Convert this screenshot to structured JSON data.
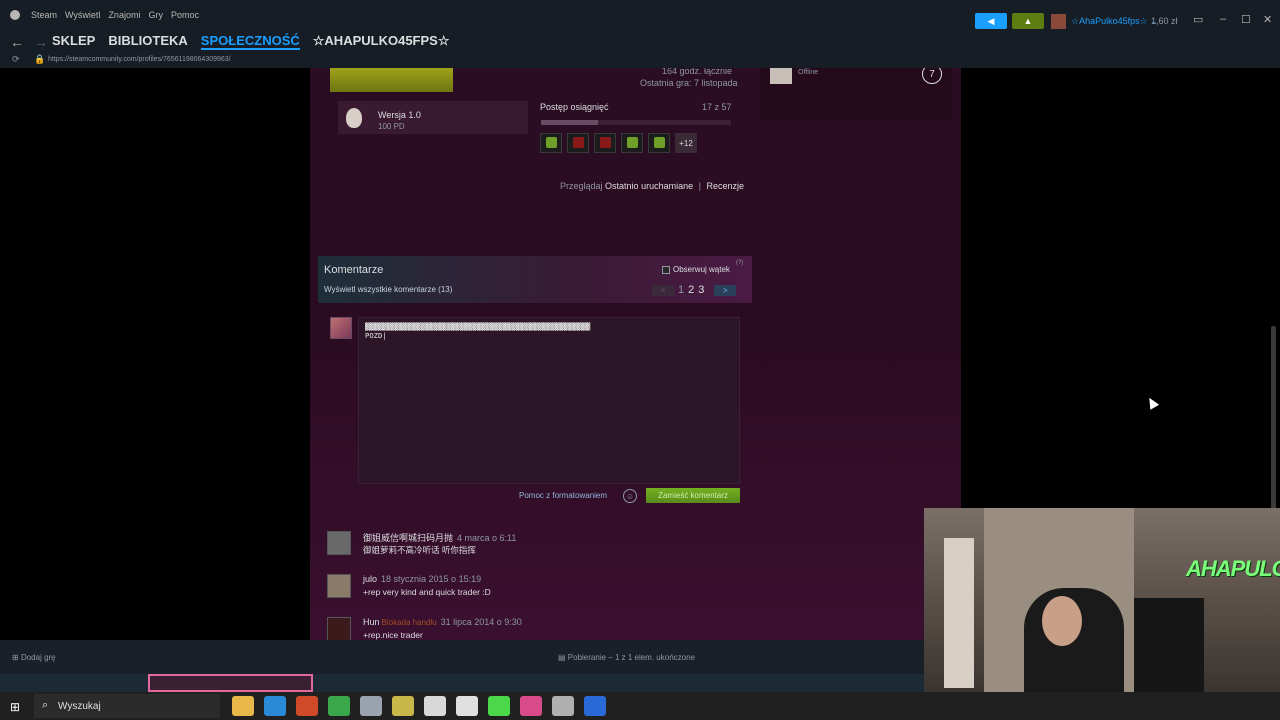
{
  "titlebar": {
    "menu": [
      "Steam",
      "Wyświetl",
      "Znajomi",
      "Gry",
      "Pomoc"
    ],
    "username": "☆AhaPulko45fps☆",
    "wallet": "1,60 zł"
  },
  "nav": {
    "links": [
      "SKLEP",
      "BIBLIOTEKA",
      "SPOŁECZNOŚĆ",
      "☆AHAPULKO45FPS☆"
    ],
    "active_index": 2,
    "url": "https://steamcommunity.com/profiles/76561198064309963/"
  },
  "game": {
    "hours": "164 godz. łącznie",
    "last_played": "Ostatnia gra: 7 listopada",
    "version_name": "Wersja 1.0",
    "version_points": "100 PD",
    "achievements_label": "Postęp osiągnięć",
    "achievements_count": "17 z 57",
    "achievements_progress": 0.3,
    "achievements_more": "+12",
    "achievement_colors": [
      "#6fa02a",
      "#8a1a1a",
      "#8a1a1a",
      "#6fa02a",
      "#6fa02a"
    ]
  },
  "browse": {
    "label": "Przeglądaj",
    "recent": "Ostatnio uruchamiane",
    "sep": "|",
    "reviews": "Recenzje"
  },
  "friend": {
    "status": "Offline",
    "count": "7"
  },
  "comments": {
    "title": "Komentarze",
    "view_all": "Wyświetl wszystkie komentarze (13)",
    "follow": "Obserwuj wątek",
    "follow_help": "(?)",
    "pages": [
      "1",
      "2",
      "3"
    ],
    "prev": "<",
    "next": ">",
    "draft": "▓▓▓▓▓▓▓▓▓▓▓▓▓▓▓▓▓▓▓▓▓▓▓▓▓▓▓▓▓▓▓▓▓▓▓▓▓▓▓▓▓▓▓▓▓▓▓▓▓▓▓▓\nPOZD|",
    "format_help": "Pomoc z formatowaniem",
    "emoji": "☺",
    "post_button": "Zamieść komentarz",
    "list": [
      {
        "author": "御姐威信啊城扫码月抛",
        "blocked": "",
        "date": "4 marca o 6:11",
        "body": "御姐萝莉不高冷听话 听你指挥",
        "avatar_color": "#6a6a6a"
      },
      {
        "author": "julo",
        "blocked": "",
        "date": "18 stycznia 2015 o 15:19",
        "body": "+rep very kind and quick trader :D",
        "avatar_color": "#8a7a6a"
      },
      {
        "author": "Hun",
        "blocked": "Blokada handlu",
        "date": "31 lipca 2014 o 9:30",
        "body": "+rep.nice trader",
        "avatar_color": "#3a1a1a"
      }
    ]
  },
  "statusbar": {
    "add_game": "Dodaj grę",
    "download": "Pobieranie – 1 z 1 elem. ukończone"
  },
  "webcam": {
    "logo": "AHAPULCO"
  },
  "taskbar": {
    "search": "Wyszukaj",
    "icon_colors": [
      "#e8b84a",
      "#2a8ad8",
      "#d04a2a",
      "#3aa84a",
      "#9aa4b0",
      "#c8b84a",
      "#d8d8d8",
      "#e0e0e0",
      "#4ad84a",
      "#d84a8a",
      "#b0b0b0",
      "#2a6ad8"
    ]
  }
}
